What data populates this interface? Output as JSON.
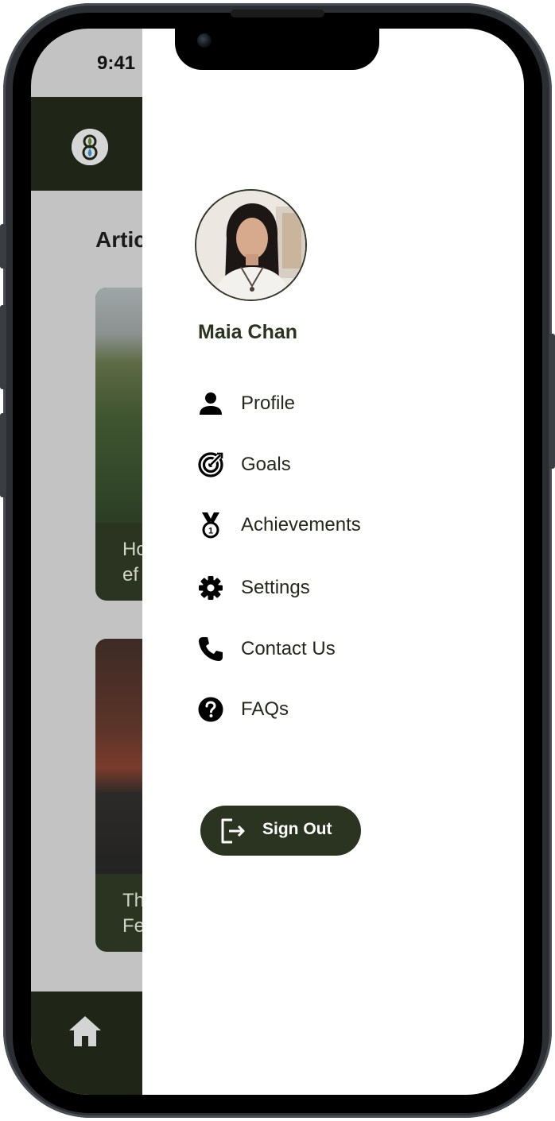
{
  "status_bar": {
    "time": "9:41"
  },
  "background_app": {
    "section_title": "Artic",
    "articles": [
      {
        "caption_line1": "Ho",
        "caption_line2": "ef"
      },
      {
        "caption_line1": "Th",
        "caption_line2": "Fe"
      }
    ],
    "bottom_nav": {
      "home_icon": "home-icon"
    }
  },
  "drawer": {
    "user_name": "Maia Chan",
    "menu": [
      {
        "label": "Profile",
        "icon": "person-icon"
      },
      {
        "label": "Goals",
        "icon": "target-icon"
      },
      {
        "label": "Achievements",
        "icon": "medal-icon"
      },
      {
        "label": "Settings",
        "icon": "gear-icon"
      },
      {
        "label": "Contact Us",
        "icon": "phone-icon"
      },
      {
        "label": "FAQs",
        "icon": "help-circle-icon"
      }
    ],
    "sign_out_label": "Sign Out"
  },
  "colors": {
    "dark_green": "#1f2617",
    "button_green": "#2a3420",
    "drawer_background": "#ffffff",
    "dim_overlay": "#c3c3c3"
  }
}
